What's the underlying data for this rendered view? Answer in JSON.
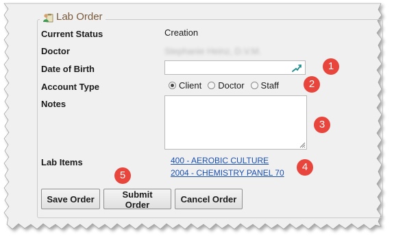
{
  "panel": {
    "title": "Lab Order",
    "icon": "user-clipboard-icon"
  },
  "fields": {
    "current_status_label": "Current Status",
    "current_status_value": "Creation",
    "doctor_label": "Doctor",
    "doctor_value": "Stephanie Heinz, D.V.M.",
    "dob_label": "Date of Birth",
    "dob_value": "",
    "account_type_label": "Account Type",
    "account_type_options": [
      "Client",
      "Doctor",
      "Staff"
    ],
    "account_type_selected": "Client",
    "notes_label": "Notes",
    "notes_value": "",
    "lab_items_label": "Lab Items",
    "lab_items": [
      "400 - AEROBIC CULTURE",
      "2004 - CHEMISTRY PANEL 70"
    ]
  },
  "buttons": {
    "save": "Save Order",
    "submit": "Submit Order",
    "cancel": "Cancel Order"
  },
  "callouts": [
    "1",
    "2",
    "3",
    "4",
    "5"
  ],
  "colors": {
    "callout": "#e8453c",
    "link": "#1a4fb0",
    "panel_bg": "#f0f0f0",
    "legend_text": "#7a5a3c"
  }
}
